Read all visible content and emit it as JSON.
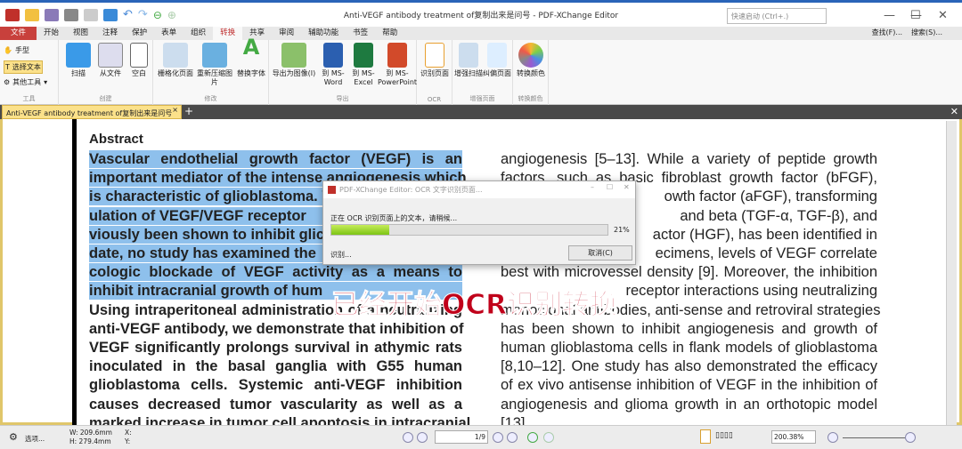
{
  "window": {
    "title": "Anti-VEGF antibody treatment of复制出来是问号 - PDF-XChange Editor",
    "quick_launch_placeholder": "快速启动 (Ctrl+.)"
  },
  "menu": {
    "items": [
      "文件",
      "开始",
      "视图",
      "注释",
      "保护",
      "表单",
      "组织",
      "转换",
      "共享",
      "审阅",
      "辅助功能",
      "书签",
      "帮助"
    ],
    "active": "转换",
    "find": "查找(F)...",
    "search": "搜索(S)..."
  },
  "ribbon": {
    "tools": {
      "hand": "手型",
      "select_text": "选择文本",
      "other_tools": "其他工具",
      "label": "工具"
    },
    "create": {
      "items": [
        "扫描",
        "从文件",
        "空白"
      ],
      "label": "创建"
    },
    "modify": {
      "items": [
        "栅格化页面",
        "重新压缩图片",
        "替换字体"
      ],
      "label": "修改"
    },
    "export": {
      "items": [
        "导出为图像(I)",
        "到 MS-Word",
        "到 MS-Excel",
        "到 MS-PowerPoint"
      ],
      "label": "导出"
    },
    "ocr": {
      "items": [
        "识别页面"
      ],
      "label": "OCR"
    },
    "enhance": {
      "items": [
        "增强扫描",
        "纠偏页面"
      ],
      "label": "增强页面"
    },
    "convert_color": {
      "items": [
        "转换颜色"
      ],
      "label": "转换颜色"
    }
  },
  "doc_tab": {
    "label": "Anti-VEGF antibody treatment of复制出来是问号"
  },
  "document": {
    "heading": "Abstract",
    "left_lines": [
      "Vascular endothelial growth factor (VEGF) is an",
      "important mediator of the intense angiogenesis which",
      "is characteristic of glioblastoma. V",
      "ulation of VEGF/VEGF receptor",
      "viously been shown to inhibit glic",
      "date, no study has examined the",
      "cologic blockade of VEGF activity as a means to",
      "inhibit intracranial growth of hum",
      "Using intraperitoneal administration of a neutralizing",
      "anti-VEGF antibody, we demonstrate that inhibition of",
      "VEGF significantly prolongs survival in athymic rats",
      "inoculated in the basal ganglia with G55 human",
      "glioblastoma cells. Systemic anti-VEGF inhibition",
      "causes decreased tumor vascularity as well as a",
      "marked increase in tumor cell apoptosis in intracranial"
    ],
    "right_lines": [
      "angiogenesis [5–13]. While a variety of peptide growth",
      "factors, such as basic fibroblast growth factor (bFGF),",
      "owth factor (aFGF), transforming",
      "and beta (TGF-α, TGF-β), and",
      "actor (HGF), has been identified in",
      "ecimens, levels of VEGF correlate",
      "best with microvessel density [9]. Moreover, the inhibition",
      "receptor interactions using neutralizing",
      "monoclonal antibodies, anti-sense and retroviral strategies",
      "has been shown to inhibit angiogenesis and growth of",
      "human glioblastoma cells in flank models of glioblastoma",
      "[8,10–12]. One study has also demonstrated the efficacy",
      "of ex vivo antisense inhibition of VEGF in the inhibition of",
      "angiogenesis and glioma growth in an orthotopic model",
      "[13]."
    ]
  },
  "dialog": {
    "title": "PDF-XChange Editor: OCR 文字识别页面...",
    "message": "正在 OCR 识别页面上的文本，请稍候...",
    "progress_percent": 21,
    "progress_label": "21%",
    "status": "识别...",
    "cancel": "取消(C)"
  },
  "overlay_caption": "已经开始OCR识别转换",
  "statusbar": {
    "options": "选项...",
    "width": "W: 209.6mm",
    "height": "H: 279.4mm",
    "x": "X:",
    "y": "Y:",
    "page": "1/9",
    "zoom": "200.38%"
  }
}
